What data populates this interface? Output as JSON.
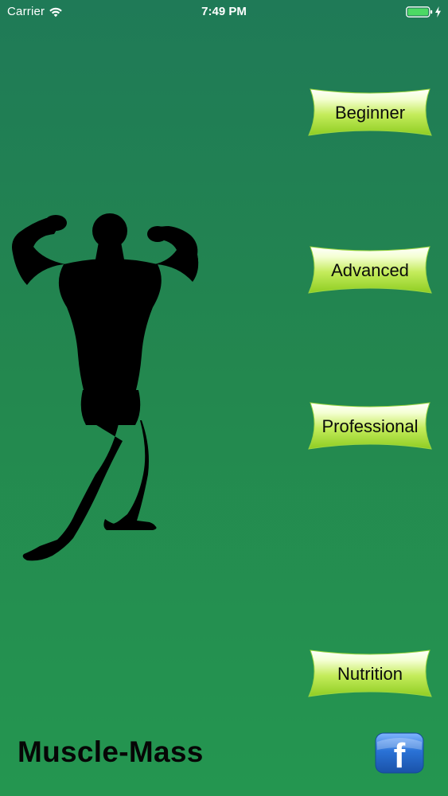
{
  "status_bar": {
    "carrier": "Carrier",
    "time": "7:49 PM",
    "wifi_icon": "wifi-icon",
    "battery_icon": "battery-full-icon",
    "charge_icon": "charging-bolt-icon"
  },
  "menu": {
    "beginner_label": "Beginner",
    "advanced_label": "Advanced",
    "professional_label": "Professional",
    "nutrition_label": "Nutrition"
  },
  "app": {
    "title": "Muscle-Mass",
    "facebook_letter": "f",
    "facebook_icon": "facebook-icon",
    "silhouette_icon": "bodybuilder-silhouette-icon"
  },
  "colors": {
    "background_top": "#1f7a57",
    "background_bottom": "#249650",
    "banner_light": "#f4ffd2",
    "banner_green": "#a3dc2c",
    "facebook_blue": "#2a72d6"
  }
}
